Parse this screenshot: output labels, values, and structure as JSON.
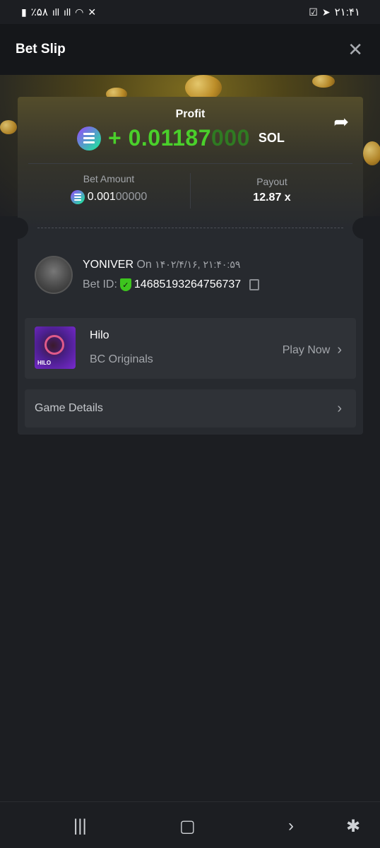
{
  "status_bar": {
    "left_text": "٪۵۸",
    "time": "۲۱:۴۱"
  },
  "header": {
    "title": "Bet Slip"
  },
  "profit": {
    "label": "Profit",
    "sign": "+ ",
    "value_main": "0.01187",
    "value_trailing": "000",
    "currency": "SOL"
  },
  "bet_amount": {
    "label": "Bet Amount",
    "value_main": "0.001",
    "value_trailing": "00000"
  },
  "payout": {
    "label": "Payout",
    "value": "12.87 x"
  },
  "user": {
    "name": "YONIVER",
    "on_label": "On",
    "datetime": "۱۴۰۲/۴/۱۶, ۲۱:۴۰:۵۹",
    "bet_id_label": "Bet ID:",
    "bet_id": "14685193264756737"
  },
  "game": {
    "thumb_text": "HILO",
    "name": "Hilo",
    "provider": "BC Originals",
    "play_label": "Play Now"
  },
  "details": {
    "label": "Game Details"
  },
  "icons": {
    "close": "close-icon",
    "share": "share-icon",
    "copy": "copy-icon",
    "shield": "shield-icon"
  },
  "colors": {
    "profit_green": "#4ad02b",
    "background": "#1c1e22",
    "card": "#272a2f"
  }
}
